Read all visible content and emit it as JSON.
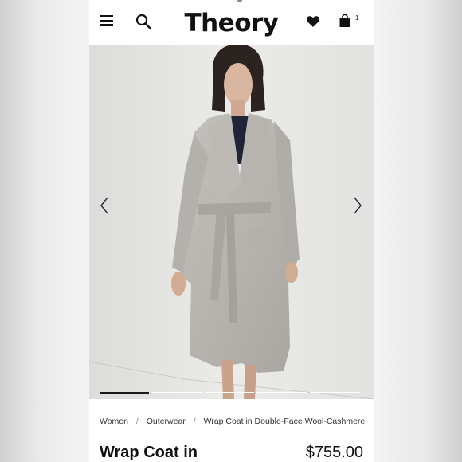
{
  "header": {
    "logo": "Theory",
    "bag_count": "1"
  },
  "icons": {
    "menu": "hamburger-menu-icon",
    "search": "search-icon",
    "wishlist": "heart-icon",
    "bag": "shopping-bag-icon",
    "prev": "chevron-left-icon",
    "next": "chevron-right-icon"
  },
  "gallery": {
    "slide_count": 5,
    "active_slide": 1
  },
  "breadcrumb": {
    "items": [
      "Women",
      "Outerwear",
      "Wrap Coat in Double-Face Wool-Cashmere"
    ],
    "separator": "/"
  },
  "product": {
    "title": "Wrap Coat in",
    "price": "$755.00"
  },
  "colors": {
    "text": "#111111",
    "coat": "#b9b6b1",
    "background": "#e6e6e4"
  }
}
